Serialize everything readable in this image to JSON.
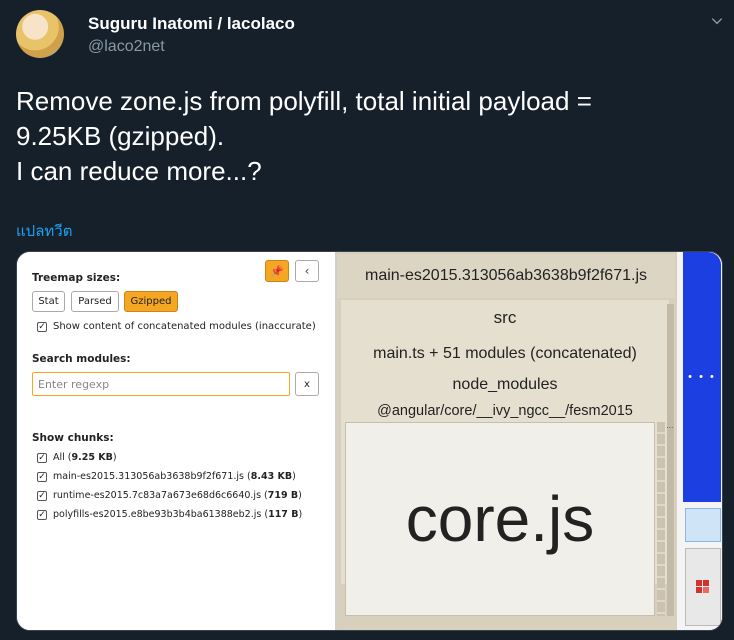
{
  "tweet": {
    "author_name": "Suguru Inatomi / lacolaco",
    "author_handle": "@laco2net",
    "text_lines": [
      "Remove zone.js from polyfill, total initial payload =",
      "9.25KB (gzipped).",
      "I can reduce more...?"
    ],
    "translate_label": "แปลทวีต"
  },
  "panel": {
    "treemap_sizes_label": "Treemap sizes:",
    "size_buttons": [
      "Stat",
      "Parsed",
      "Gzipped"
    ],
    "active_size": "Gzipped",
    "show_content_label": "Show content of concatenated modules (inaccurate)",
    "search_label": "Search modules:",
    "search_placeholder": "Enter regexp",
    "clear_label": "x",
    "pin_icon": "pin-icon",
    "collapse_icon": "chevron-left-icon",
    "show_chunks_label": "Show chunks:",
    "chunks": [
      {
        "name": "All",
        "size": "9.25 KB"
      },
      {
        "name": "main-es2015.313056ab3638b9f2f671.js",
        "size": "8.43 KB"
      },
      {
        "name": "runtime-es2015.7c83a7a673e68d6c6640.js",
        "size": "719 B"
      },
      {
        "name": "polyfills-es2015.e8be93b3b4ba61388eb2.js",
        "size": "117 B"
      }
    ]
  },
  "treemap": {
    "bundle_label": "main-es2015.313056ab3638b9f2f671.js",
    "src_label": "src",
    "main_label": "main.ts + 51 modules (concatenated)",
    "node_modules_label": "node_modules",
    "angular_label": "@angular/core/__ivy_ngcc__/fesm2015",
    "core_label": "core.js",
    "right_dots": "..."
  },
  "colors": {
    "background": "#15202b",
    "accent": "#1da1f2",
    "active_button": "#f5a623",
    "chunk_blue": "#1b3fe0"
  }
}
